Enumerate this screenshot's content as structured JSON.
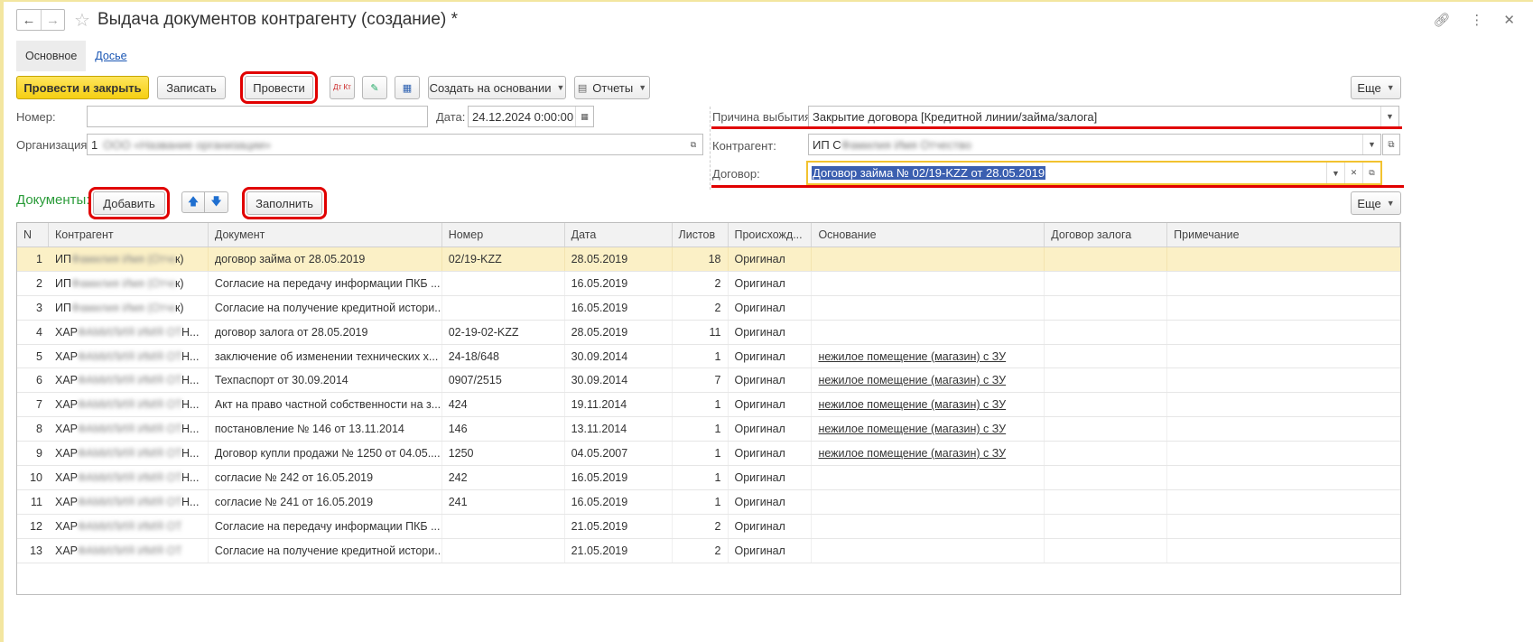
{
  "window": {
    "title": "Выдача документов контрагенту (создание) *"
  },
  "tabs": [
    {
      "label": "Основное"
    },
    {
      "label": "Досье"
    }
  ],
  "toolbar": {
    "post_close": "Провести и закрыть",
    "save": "Записать",
    "post": "Провести",
    "create_based": "Создать на основании",
    "reports": "Отчеты",
    "more": "Еще",
    "dt_kt_icon_text": "Дт Кт"
  },
  "form": {
    "number_label": "Номер:",
    "number_value": "",
    "date_label": "Дата:",
    "date_value": "24.12.2024  0:00:00",
    "org_label": "Организация:",
    "org_value": "1",
    "org_blurred": "ООО «Название организации»",
    "reason_label": "Причина выбытия:",
    "reason_value": "Закрытие договора [Кредитной линии/займа/залога]",
    "counterparty_label": "Контрагент:",
    "counterparty_value": "ИП С",
    "counterparty_blurred": "Фамилия Имя Отчество",
    "contract_label": "Договор:",
    "contract_value": "Договор займа № 02/19-KZZ от 28.05.2019"
  },
  "documents": {
    "title": "Документы:",
    "add": "Добавить",
    "fill": "Заполнить",
    "more": "Еще",
    "columns": [
      "N",
      "Контрагент",
      "Документ",
      "Номер",
      "Дата",
      "Листов",
      "Происхожд...",
      "Основание",
      "Договор залога",
      "Примечание"
    ],
    "rows": [
      {
        "n": "1",
        "cp": "ИП",
        "cp_blur": "Фамилия Имя (Отчест",
        "cp_tail": "к)",
        "doc": "договор займа от 28.05.2019",
        "num": "02/19-KZZ",
        "date": "28.05.2019",
        "sheets": "18",
        "origin": "Оригинал",
        "basis": "",
        "pledge": "",
        "note": ""
      },
      {
        "n": "2",
        "cp": "ИП",
        "cp_blur": "Фамилия Имя (Отчест",
        "cp_tail": "к)",
        "doc": "Согласие на передачу информации ПКБ ...",
        "num": "",
        "date": "16.05.2019",
        "sheets": "2",
        "origin": "Оригинал",
        "basis": "",
        "pledge": "",
        "note": ""
      },
      {
        "n": "3",
        "cp": "ИП",
        "cp_blur": "Фамилия Имя (Отчест",
        "cp_tail": "к)",
        "doc": "Согласие на получение кредитной истори...",
        "num": "",
        "date": "16.05.2019",
        "sheets": "2",
        "origin": "Оригинал",
        "basis": "",
        "pledge": "",
        "note": ""
      },
      {
        "n": "4",
        "cp": "ХАР",
        "cp_blur": "ФАМИЛИЯ ИМЯ ОТЧЕСТВ",
        "cp_tail": "Н...",
        "doc": "договор залога от 28.05.2019",
        "num": "02-19-02-KZZ",
        "date": "28.05.2019",
        "sheets": "11",
        "origin": "Оригинал",
        "basis": "",
        "pledge": "",
        "note": ""
      },
      {
        "n": "5",
        "cp": "ХАР",
        "cp_blur": "ФАМИЛИЯ ИМЯ ОТЧЕСТВ",
        "cp_tail": "Н...",
        "doc": "заключение об изменении технических х...",
        "num": "24-18/648",
        "date": "30.09.2014",
        "sheets": "1",
        "origin": "Оригинал",
        "basis": "нежилое помещение (магазин) с ЗУ",
        "pledge": "",
        "note": ""
      },
      {
        "n": "6",
        "cp": "ХАР",
        "cp_blur": "ФАМИЛИЯ ИМЯ ОТЧЕСТВ",
        "cp_tail": "Н...",
        "doc": "Техпаспорт от 30.09.2014",
        "num": "0907/2515",
        "date": "30.09.2014",
        "sheets": "7",
        "origin": "Оригинал",
        "basis": "нежилое помещение (магазин) с ЗУ",
        "pledge": "",
        "note": ""
      },
      {
        "n": "7",
        "cp": "ХАР",
        "cp_blur": "ФАМИЛИЯ ИМЯ ОТЧЕСТВ",
        "cp_tail": "Н...",
        "doc": "Акт на право частной собственности на з...",
        "num": "424",
        "date": "19.11.2014",
        "sheets": "1",
        "origin": "Оригинал",
        "basis": "нежилое помещение (магазин) с ЗУ",
        "pledge": "",
        "note": ""
      },
      {
        "n": "8",
        "cp": "ХАР",
        "cp_blur": "ФАМИЛИЯ ИМЯ ОТЧЕСТВ",
        "cp_tail": "Н...",
        "doc": "постановление № 146 от 13.11.2014",
        "num": "146",
        "date": "13.11.2014",
        "sheets": "1",
        "origin": "Оригинал",
        "basis": "нежилое помещение (магазин) с ЗУ",
        "pledge": "",
        "note": ""
      },
      {
        "n": "9",
        "cp": "ХАР",
        "cp_blur": "ФАМИЛИЯ ИМЯ ОТЧЕСТВ",
        "cp_tail": "Н...",
        "doc": "Договор купли продажи № 1250 от 04.05....",
        "num": "1250",
        "date": "04.05.2007",
        "sheets": "1",
        "origin": "Оригинал",
        "basis": "нежилое помещение (магазин) с ЗУ",
        "pledge": "",
        "note": ""
      },
      {
        "n": "10",
        "cp": "ХАР",
        "cp_blur": "ФАМИЛИЯ ИМЯ ОТЧЕСТВ",
        "cp_tail": "Н...",
        "doc": "согласие № 242 от 16.05.2019",
        "num": "242",
        "date": "16.05.2019",
        "sheets": "1",
        "origin": "Оригинал",
        "basis": "",
        "pledge": "",
        "note": ""
      },
      {
        "n": "11",
        "cp": "ХАР",
        "cp_blur": "ФАМИЛИЯ ИМЯ ОТЧЕСТВ",
        "cp_tail": "Н...",
        "doc": "согласие № 241 от 16.05.2019",
        "num": "241",
        "date": "16.05.2019",
        "sheets": "1",
        "origin": "Оригинал",
        "basis": "",
        "pledge": "",
        "note": ""
      },
      {
        "n": "12",
        "cp": "ХАР",
        "cp_blur": "ФАМИЛИЯ ИМЯ ОТЧЕСТВ",
        "cp_tail": "",
        "doc": "Согласие на передачу информации ПКБ ...",
        "num": "",
        "date": "21.05.2019",
        "sheets": "2",
        "origin": "Оригинал",
        "basis": "",
        "pledge": "",
        "note": ""
      },
      {
        "n": "13",
        "cp": "ХАР",
        "cp_blur": "ФАМИЛИЯ ИМЯ ОТЧЕСТВ",
        "cp_tail": "",
        "doc": "Согласие на получение кредитной истори...",
        "num": "",
        "date": "21.05.2019",
        "sheets": "2",
        "origin": "Оригинал",
        "basis": "",
        "pledge": "",
        "note": ""
      }
    ]
  },
  "colors": {
    "highlight": "#e10000",
    "primary_button": "#f5cf12",
    "section_title": "#2b9c3a",
    "selected_row": "#fbf0c6"
  }
}
